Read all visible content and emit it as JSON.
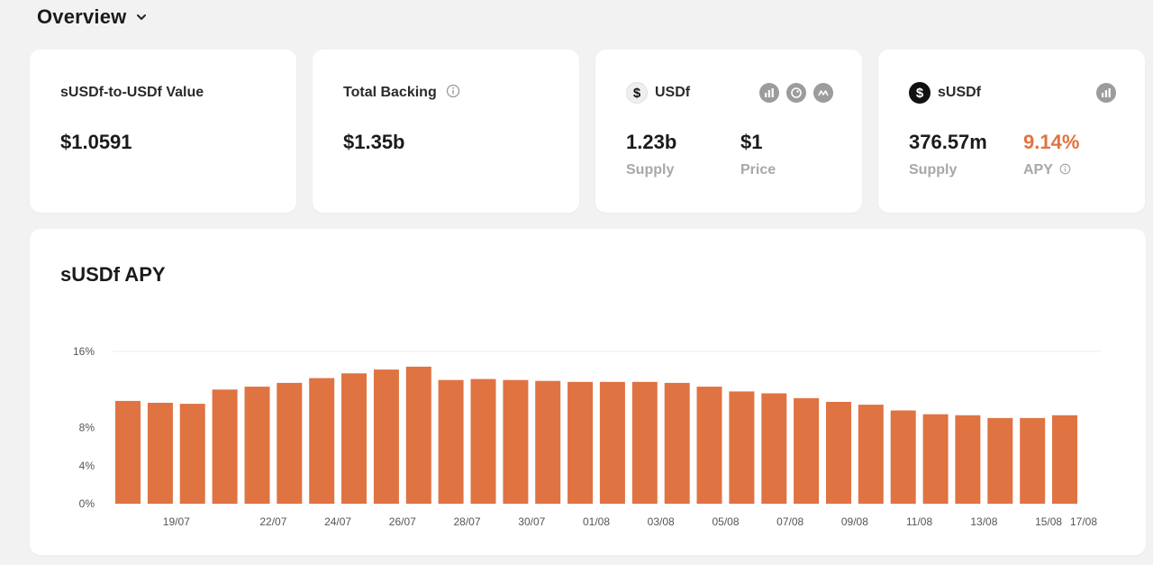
{
  "header": {
    "title": "Overview"
  },
  "cards": {
    "value_card": {
      "label": "sUSDf-to-USDf Value",
      "value": "$1.0591"
    },
    "backing_card": {
      "label": "Total Backing",
      "value": "$1.35b"
    },
    "usdf_card": {
      "token": "USDf",
      "supply_value": "1.23b",
      "supply_label": "Supply",
      "price_value": "$1",
      "price_label": "Price"
    },
    "susdf_card": {
      "token": "sUSDf",
      "supply_value": "376.57m",
      "supply_label": "Supply",
      "apy_value": "9.14%",
      "apy_label": "APY"
    }
  },
  "colors": {
    "accent": "#e07340",
    "bar": "#e07342",
    "background": "#f2f2f2"
  },
  "chart_data": {
    "type": "bar",
    "title": "sUSDf APY",
    "xlabel": "",
    "ylabel": "",
    "ylim": [
      0,
      16
    ],
    "yticks": [
      0,
      4,
      8,
      16
    ],
    "ytick_labels": [
      "0%",
      "4%",
      "8%",
      "16%"
    ],
    "categories": [
      "18/07",
      "19/07",
      "20/07",
      "21/07",
      "22/07",
      "23/07",
      "24/07",
      "25/07",
      "26/07",
      "27/07",
      "28/07",
      "29/07",
      "30/07",
      "31/07",
      "01/08",
      "02/08",
      "03/08",
      "04/08",
      "05/08",
      "06/08",
      "07/08",
      "08/08",
      "09/08",
      "10/08",
      "11/08",
      "12/08",
      "13/08",
      "14/08",
      "15/08",
      "16/08",
      "17/08"
    ],
    "xtick_labels": [
      "19/07",
      "22/07",
      "24/07",
      "26/07",
      "28/07",
      "30/07",
      "01/08",
      "03/08",
      "05/08",
      "07/08",
      "09/08",
      "11/08",
      "13/08",
      "15/08",
      "17/08"
    ],
    "values": [
      10.8,
      10.6,
      10.5,
      12.0,
      12.3,
      12.7,
      13.2,
      13.7,
      14.1,
      14.4,
      13.0,
      13.1,
      13.0,
      12.9,
      12.8,
      12.8,
      12.8,
      12.7,
      12.3,
      11.8,
      11.6,
      11.1,
      10.7,
      10.4,
      9.8,
      9.4,
      9.3,
      9.0,
      9.0,
      9.3
    ]
  }
}
